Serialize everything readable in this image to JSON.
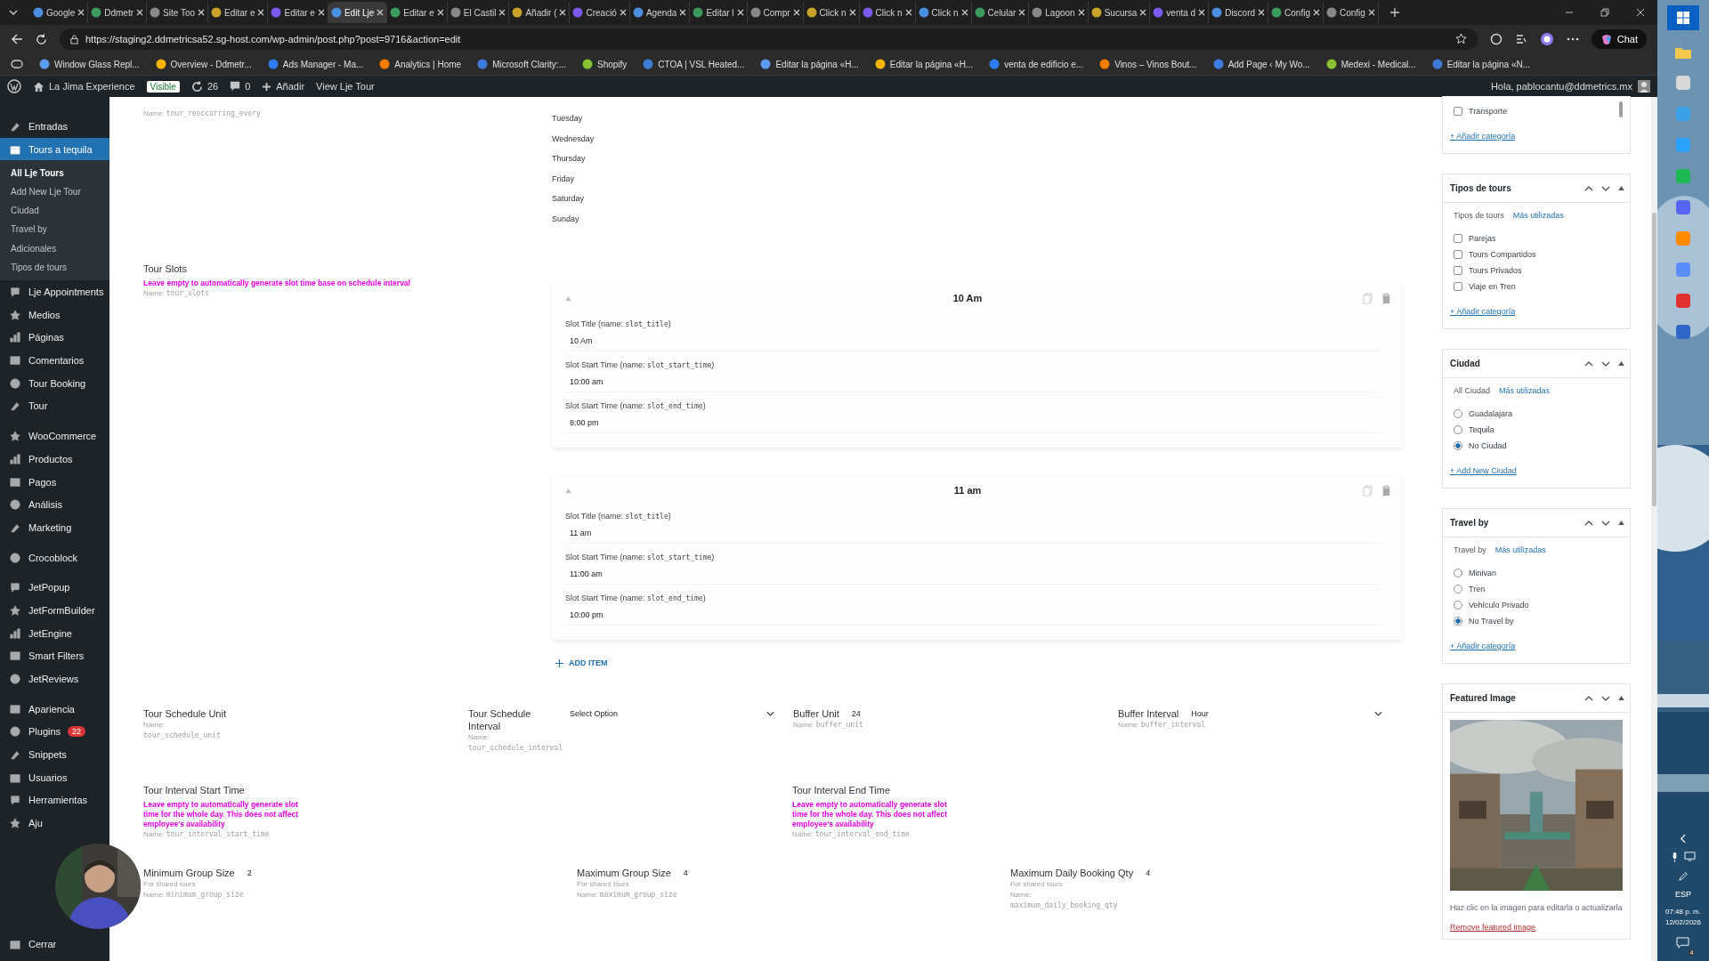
{
  "browser": {
    "tabs": [
      {
        "title": "Google",
        "selected": false
      },
      {
        "title": "Ddmetr",
        "selected": false
      },
      {
        "title": "Site Too",
        "selected": false
      },
      {
        "title": "Editar e",
        "selected": false
      },
      {
        "title": "Editar e",
        "selected": false
      },
      {
        "title": "Edit Lje",
        "selected": true
      },
      {
        "title": "Editar e",
        "selected": false
      },
      {
        "title": "El Castil",
        "selected": false
      },
      {
        "title": "Añadir (",
        "selected": false
      },
      {
        "title": "Creació",
        "selected": false
      },
      {
        "title": "Agenda",
        "selected": false
      },
      {
        "title": "Editar l",
        "selected": false
      },
      {
        "title": "Compr",
        "selected": false
      },
      {
        "title": "Click n",
        "selected": false
      },
      {
        "title": "Click n",
        "selected": false
      },
      {
        "title": "Click n",
        "selected": false
      },
      {
        "title": "Celular",
        "selected": false
      },
      {
        "title": "Lagoon",
        "selected": false
      },
      {
        "title": "Sucursa",
        "selected": false
      },
      {
        "title": "venta d",
        "selected": false
      },
      {
        "title": "Discord",
        "selected": false
      },
      {
        "title": "Config",
        "selected": false
      },
      {
        "title": "Config",
        "selected": false
      }
    ],
    "address": "https://staging2.ddmetricsa52.sg-host.com/wp-admin/post.php?post=9716&action=edit",
    "chat": "Chat",
    "bookmarks": [
      "Window Glass Repl...",
      "Overview - Ddmetr...",
      "Ads Manager - Ma...",
      "Analytics | Home",
      "Microsoft Clarity:...",
      "Shopify",
      "CTOA | VSL Heated...",
      "Editar la página «H...",
      "Editar la página «H...",
      "venta de edificio e...",
      "Vinos – Vinos Bout...",
      "Add Page ‹ My Wo...",
      "Medexi - Medical...",
      "Editar la página «N..."
    ]
  },
  "admin_bar": {
    "site": "La Jima Experience",
    "visibility": "Visible",
    "updates": "26",
    "comments": "0",
    "new": "Añadir",
    "view": "View Lje Tour",
    "greeting": "Hola, pablocantu@ddmetrics.mx"
  },
  "sidebar": {
    "groups": [
      [
        {
          "label": "Entradas",
          "selected": false
        },
        {
          "label": "Tours a tequila",
          "selected": true,
          "children": [
            {
              "label": "All Lje Tours",
              "selected": true
            },
            {
              "label": "Add New Lje Tour",
              "selected": false
            },
            {
              "label": "Ciudad",
              "selected": false
            },
            {
              "label": "Travel by",
              "selected": false
            },
            {
              "label": "Adicionales",
              "selected": false
            },
            {
              "label": "Tipos de tours",
              "selected": false
            }
          ]
        },
        {
          "label": "Lje Appointments",
          "selected": false
        },
        {
          "label": "Medios",
          "selected": false
        },
        {
          "label": "Páginas",
          "selected": false
        },
        {
          "label": "Comentarios",
          "selected": false
        },
        {
          "label": "Tour Booking",
          "selected": false
        },
        {
          "label": "Tour",
          "selected": false
        }
      ],
      [
        {
          "label": "WooCommerce",
          "selected": false
        },
        {
          "label": "Productos",
          "selected": false
        },
        {
          "label": "Pagos",
          "selected": false
        },
        {
          "label": "Análisis",
          "selected": false
        },
        {
          "label": "Marketing",
          "selected": false
        }
      ],
      [
        {
          "label": "Crocoblock",
          "selected": false
        }
      ],
      [
        {
          "label": "JetPopup",
          "selected": false
        },
        {
          "label": "JetFormBuilder",
          "selected": false
        },
        {
          "label": "JetEngine",
          "selected": false
        },
        {
          "label": "Smart Filters",
          "selected": false
        },
        {
          "label": "JetReviews",
          "selected": false
        }
      ],
      [
        {
          "label": "Apariencia",
          "selected": false
        },
        {
          "label": "Plugins",
          "selected": false,
          "badge": "22"
        },
        {
          "label": "Snippets",
          "selected": false
        },
        {
          "label": "Usuarios",
          "selected": false
        },
        {
          "label": "Herramientas",
          "selected": false
        },
        {
          "label": "Aju",
          "selected": false
        }
      ],
      [
        {
          "label": "Cerrar",
          "selected": false
        }
      ]
    ]
  },
  "form": {
    "reoccurring_name": {
      "prefix": "Name:",
      "code": "tour_reoccurring_every"
    },
    "days": [
      "Tuesday",
      "Wednesday",
      "Thursday",
      "Friday",
      "Saturday",
      "Sunday"
    ],
    "tour_slots": {
      "label": "Tour Slots",
      "hint": "Leave empty to automatically generate slot time base on schedule interval",
      "name": {
        "prefix": "Name:",
        "code": "tour_slots"
      },
      "items": [
        {
          "title": "10 Am",
          "expanded": true,
          "fields": [
            {
              "prefix": "Slot Title (name: ",
              "code": "slot_title",
              "suffix": ")",
              "value": "10 Am"
            },
            {
              "prefix": "Slot Start Time (name: ",
              "code": "slot_start_time",
              "suffix": ")",
              "value": "10:00 am"
            },
            {
              "prefix": "Slot Start Time (name: ",
              "code": "slot_end_time",
              "suffix": ")",
              "value": "8:00 pm"
            }
          ]
        },
        {
          "title": "11 am",
          "expanded": true,
          "fields": [
            {
              "prefix": "Slot Title (name: ",
              "code": "slot_title",
              "suffix": ")",
              "value": "11 am"
            },
            {
              "prefix": "Slot Start Time (name: ",
              "code": "slot_start_time",
              "suffix": ")",
              "value": "11:00 am"
            },
            {
              "prefix": "Slot Start Time (name: ",
              "code": "slot_end_time",
              "suffix": ")",
              "value": "10:00 pm"
            }
          ]
        }
      ],
      "add_item": "ADD ITEM"
    },
    "rows": [
      [
        {
          "label": "Tour Schedule Unit",
          "kind": "text",
          "name": {
            "prefix": "Name:",
            "code": "tour_schedule_unit",
            "wrap": true
          }
        },
        {
          "label": "Tour Schedule Interval",
          "kind": "select",
          "value": "Select Option",
          "name": {
            "prefix": "Name:",
            "code": "tour_schedule_interval",
            "wrap": true
          }
        },
        {
          "label": "Buffer Unit",
          "kind": "text",
          "value": "24",
          "name": {
            "prefix": "Name:",
            "code": "buffer_unit",
            "wrap": false
          }
        },
        {
          "label": "Buffer Interval",
          "kind": "select",
          "value": "Hour",
          "name": {
            "prefix": "Name:",
            "code": "buffer_interval",
            "wrap": false
          }
        }
      ],
      [
        {
          "label": "Tour Interval Start Time",
          "kind": "time",
          "hint": "Leave empty to automatically generate slot time for the whole day. This does not affect employee's availability",
          "name": {
            "prefix": "Name:",
            "code": "tour_interval_start_time",
            "wrap": false
          }
        },
        {
          "label": "Tour Interval End Time",
          "kind": "time",
          "hint": "Leave empty to automatically generate slot time for the whole day. This does not affect employee's availability",
          "name": {
            "prefix": "Name:",
            "code": "tour_interval_end_time",
            "wrap": false
          }
        }
      ],
      [
        {
          "label": "Minimum Group Size",
          "kind": "text",
          "value": "2",
          "note": "For shared tours",
          "name": {
            "prefix": "Name:",
            "code": "minimum_group_size",
            "wrap": false
          }
        },
        {
          "label": "Maximum Group Size",
          "kind": "text",
          "value": "4",
          "note": "For shared tours",
          "name": {
            "prefix": "Name:",
            "code": "maximum_group_size",
            "wrap": false
          }
        },
        {
          "label": "Maximum Daily Booking Qty",
          "kind": "text",
          "value": "4",
          "note": "For shared tours",
          "name": {
            "prefix": "Name:",
            "code": "maximum_daily_booking_qty",
            "wrap": true
          }
        }
      ]
    ]
  },
  "metaboxes": [
    {
      "kind": "checklist",
      "partial": true,
      "items": [
        {
          "label": "Transporte",
          "checked": false
        }
      ],
      "add_link": "+ Añadir categoría"
    },
    {
      "kind": "checklist",
      "title": "Tipos de tours",
      "tabs": [
        {
          "label": "Tipos de tours",
          "selected": true
        },
        {
          "label": "Más utilizadas",
          "selected": false
        }
      ],
      "items": [
        {
          "label": "Parejas",
          "checked": false
        },
        {
          "label": "Tours Compartidos",
          "checked": false
        },
        {
          "label": "Tours Privados",
          "checked": false
        },
        {
          "label": "Viaje en Tren",
          "checked": false
        }
      ],
      "add_link": "+ Añadir categoría"
    },
    {
      "kind": "radiolist",
      "title": "Ciudad",
      "tabs": [
        {
          "label": "All Ciudad",
          "selected": true
        },
        {
          "label": "Más utilizadas",
          "selected": false
        }
      ],
      "items": [
        {
          "label": "Guadalajara",
          "checked": false
        },
        {
          "label": "Tequila",
          "checked": false
        },
        {
          "label": "No Ciudad",
          "checked": true
        }
      ],
      "add_link": "+ Add New Ciudad"
    },
    {
      "kind": "radiolist",
      "title": "Travel by",
      "tabs": [
        {
          "label": "Travel by",
          "selected": true
        },
        {
          "label": "Más utilizadas",
          "selected": false
        }
      ],
      "items": [
        {
          "label": "Minivan",
          "checked": false
        },
        {
          "label": "Tren",
          "checked": false
        },
        {
          "label": "Vehículo Privado",
          "checked": false
        },
        {
          "label": "No Travel by",
          "checked": true
        }
      ],
      "add_link": "+ Añadir categoría"
    },
    {
      "title": "Featured Image",
      "caption": "Haz clic en la imagen para editarla o actualizarla",
      "remove_link": "Remove featured image"
    }
  ],
  "taskbar": {
    "language": "ESP",
    "time": "07:48 p. m.",
    "date": "12/02/2026",
    "notifications": "4"
  }
}
